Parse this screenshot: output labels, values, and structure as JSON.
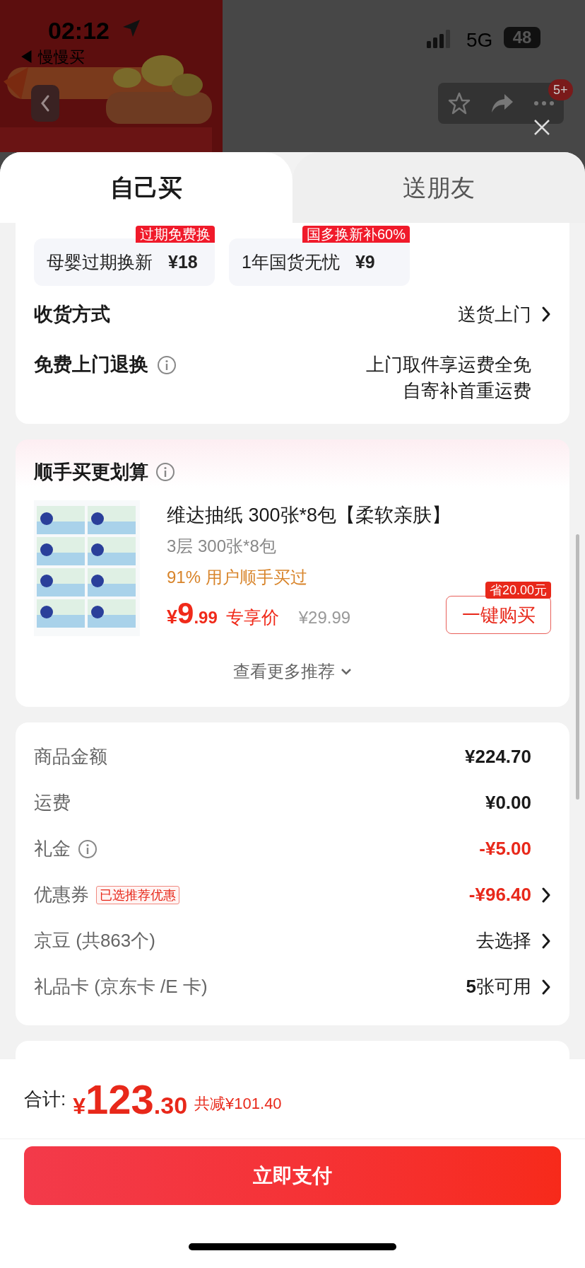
{
  "status_bar": {
    "time": "02:12",
    "back_app": "◀ 慢慢买",
    "network": "5G",
    "battery": "48"
  },
  "header": {
    "badge": "5+"
  },
  "tabs": [
    {
      "label": "自己买",
      "selected": true
    },
    {
      "label": "送朋友",
      "selected": false
    }
  ],
  "services": [
    {
      "tag": "过期免费换",
      "name": "母婴过期换新",
      "price": "¥18"
    },
    {
      "tag": "国多换新补60%",
      "name": "1年国货无忧",
      "price": "¥9"
    }
  ],
  "delivery": {
    "label": "收货方式",
    "value": "送货上门"
  },
  "returns": {
    "label": "免费上门退换",
    "lines": [
      "上门取件享运费全免",
      "自寄补首重运费"
    ]
  },
  "addon": {
    "title": "顺手买更划算",
    "product": {
      "title": "维达抽纸 300张*8包【柔软亲肤】",
      "spec": "3层 300张*8包",
      "note": "91% 用户顺手买过",
      "currency": "¥",
      "price_int": "9",
      "price_dec": ".99",
      "price_label": "专享价",
      "original_price": "¥29.99",
      "button": "一键购买",
      "saving": "省20.00元"
    },
    "more": "查看更多推荐"
  },
  "summary": [
    {
      "label": "商品金额",
      "value": "¥224.70",
      "kind": "amount",
      "info": false,
      "highlight": false,
      "chevron": false
    },
    {
      "label": "运费",
      "value": "¥0.00",
      "kind": "amount",
      "info": false,
      "highlight": false,
      "chevron": false
    },
    {
      "label": "礼金",
      "value": "-¥5.00",
      "kind": "amount",
      "info": true,
      "highlight": true,
      "chevron": false
    },
    {
      "label": "优惠券",
      "tag": "已选推荐优惠",
      "value": "-¥96.40",
      "kind": "amount",
      "info": false,
      "highlight": true,
      "chevron": true
    },
    {
      "label": "京豆 (共863个)",
      "value": "去选择",
      "kind": "action",
      "info": false,
      "highlight": false,
      "chevron": true
    },
    {
      "label": "礼品卡 (京东卡 /E 卡)",
      "value": "**5**张可用",
      "kind": "action",
      "info": false,
      "highlight": false,
      "chevron": true
    }
  ],
  "footer": {
    "label": "合计:",
    "currency": "¥",
    "total_int": "123",
    "total_dec": ".30",
    "saving": "共减¥101.40",
    "pay_button": "立即支付"
  }
}
